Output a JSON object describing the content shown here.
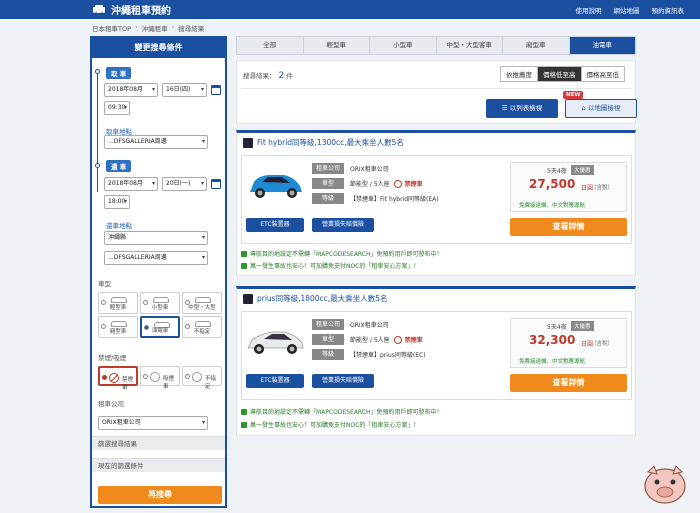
{
  "header": {
    "title": "沖繩租車預約",
    "links": [
      "使用說明",
      "網站地圖",
      "預約資訊表"
    ]
  },
  "breadcrumb": [
    "日本租車TOP",
    "沖繩租車",
    "搜尋結果"
  ],
  "sidebar": {
    "title": "變更搜尋條件",
    "pickup": {
      "tag": "取 車",
      "year_month": "2018年08月",
      "day": "16日(四)",
      "time": "09:30",
      "location_label": "取車地點",
      "location": "...DFSGALLERIA周邊"
    },
    "return": {
      "tag": "還 車",
      "year_month": "2018年08月",
      "day": "20日(一)",
      "time": "18:00",
      "location_label": "還車地點",
      "area": "沖繩縣",
      "location": "...DFSGALLERIA周邊"
    },
    "car_type_label": "車型",
    "car_types": [
      {
        "label": "輕型車"
      },
      {
        "label": "小型車"
      },
      {
        "label": "中型・大型"
      },
      {
        "label": "廂型車"
      },
      {
        "label": "油電車"
      },
      {
        "label": "不指定"
      }
    ],
    "smoke_label": "禁煙/吸煙",
    "smoke_options": [
      {
        "label": "禁煙車"
      },
      {
        "label": "吸煙車"
      },
      {
        "label": "不指定"
      }
    ],
    "company_label": "租車公司",
    "company": "ORIX租車公司",
    "collapse_1": "篩選搜尋結果",
    "collapse_2": "現在的篩選條件",
    "search_button": "再搜尋"
  },
  "tabs": [
    "全部",
    "輕型車",
    "小型車",
    "中型・大型客車",
    "廂型車",
    "油電車"
  ],
  "results": {
    "count_label": "搜尋結果：",
    "count": "2",
    "count_unit": "件",
    "sort": [
      "依推薦度",
      "價格低至高",
      "價格高至低"
    ],
    "list_view": "以列表檢視",
    "map_view": "以地圖檢視",
    "new_badge": "NEW"
  },
  "cars": [
    {
      "title": "Fit   hybrid同等級,1300cc,最大乘坐人數5名",
      "company_key": "租車公司",
      "company": "ORIX租車公司",
      "type_key": "車型",
      "type": "節能型 / 5人座",
      "nosmoke": "禁煙車",
      "class_key": "等級",
      "class": "【禁煙車】Fit  hybrid同等級(EA)",
      "days": "5天4夜",
      "discount": "大優惠",
      "price": "27,500",
      "yen": "日圓",
      "tax": "（含稅）",
      "free": "免費接送機、中文對應導航",
      "etc_button": "ETC裝置器",
      "insurance_button": "營業損失賠償險",
      "detail_button": "查看詳情",
      "note_1": "導航目的地設定不需轉「MAPCODESEARCH」免預約用戶即可發布中！",
      "note_2": "萬一發生事故也安心！可加購免支付NOC的「租車安心方案」！"
    },
    {
      "title": "prius同等級,1800cc,最大乘坐人數5名",
      "company_key": "租車公司",
      "company": "ORIX租車公司",
      "type_key": "車型",
      "type": "節能型 / 5人座",
      "nosmoke": "禁煙車",
      "class_key": "等級",
      "class": "【禁煙車】prius同等級(EC)",
      "days": "5天4夜",
      "discount": "大優惠",
      "price": "32,300",
      "yen": "日圓",
      "tax": "（含稅）",
      "free": "免費接送機、中文對應導航",
      "etc_button": "ETC裝置器",
      "insurance_button": "營業損失賠償險",
      "detail_button": "查看詳情",
      "note_1": "導航目的地設定不需轉「MAPCODESEARCH」免預約用戶即可發布中！",
      "note_2": "萬一發生事故也安心！可加購免支付NOC的「租車安心方案」！"
    }
  ],
  "colors": {
    "primary": "#1b4fa0",
    "accent": "#f08a1c",
    "price": "#c0392b",
    "note": "#2a8a2a"
  }
}
